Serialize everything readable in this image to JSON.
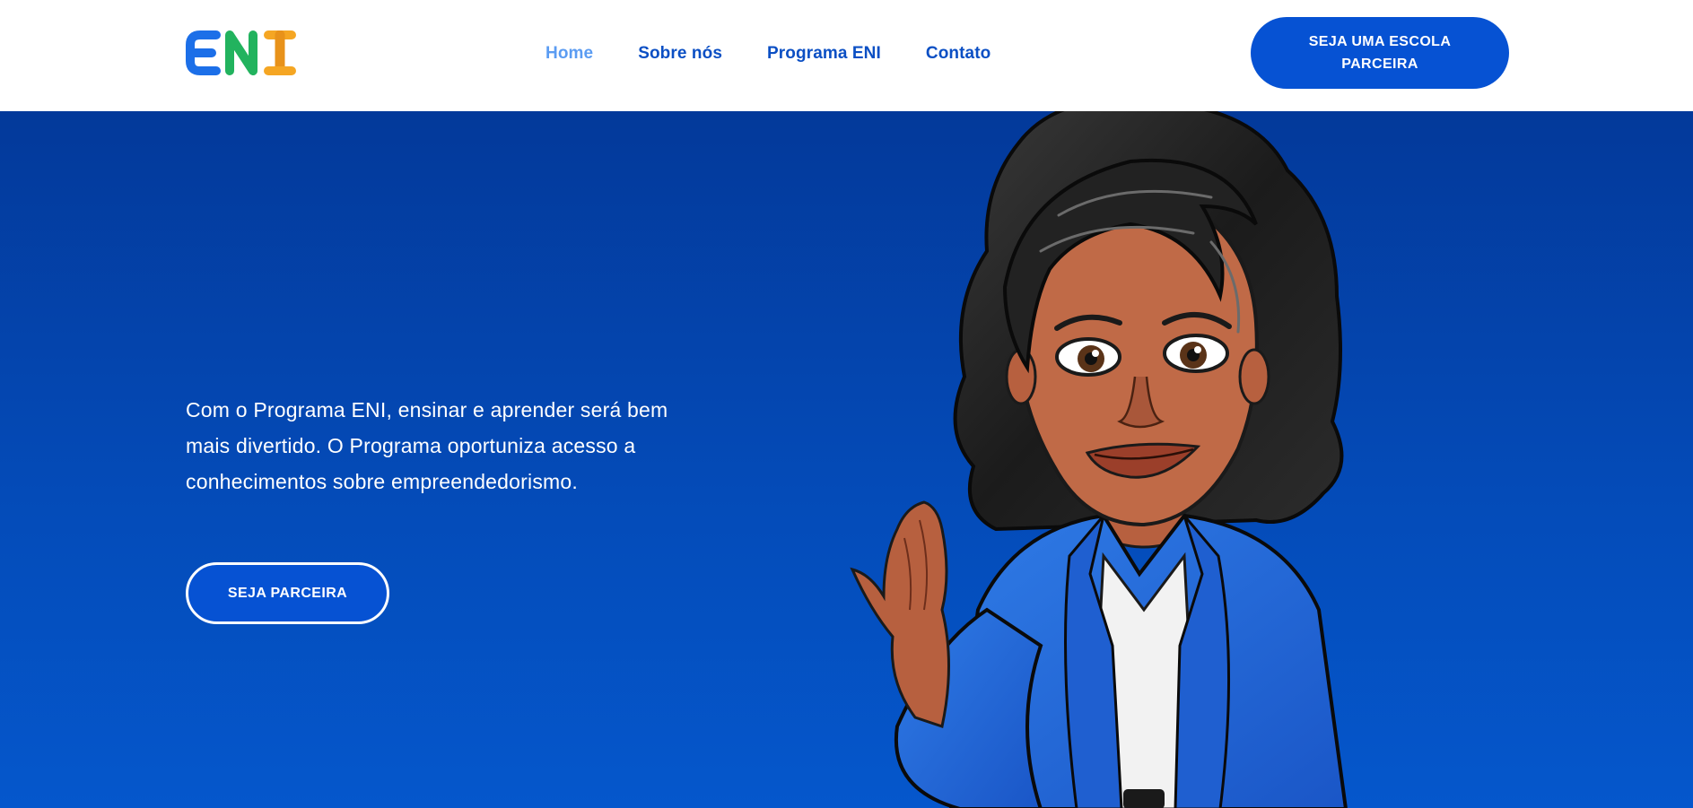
{
  "header": {
    "logo_text": "ENI",
    "logo_colors": [
      "#1c6fe8",
      "#22b35e",
      "#f5a623"
    ],
    "nav": [
      {
        "label": "Home",
        "active": true
      },
      {
        "label": "Sobre nós",
        "active": false
      },
      {
        "label": "Programa ENI",
        "active": false
      },
      {
        "label": "Contato",
        "active": false
      }
    ],
    "cta_label": "SEJA UMA ESCOLA PARCEIRA"
  },
  "hero": {
    "text": "Com o Programa ENI, ensinar e aprender será bem mais divertido. O Programa oportuniza acesso a conhecimentos sobre empreendedorismo.",
    "cta_label": "SEJA PARCEIRA",
    "illustration": "cartoon-woman-waving"
  },
  "colors": {
    "primary": "#0652d3",
    "nav_text": "#0b4fc4",
    "nav_active": "#5b9cf2",
    "hero_top": "#03399a",
    "hero_bottom": "#0557cc"
  }
}
